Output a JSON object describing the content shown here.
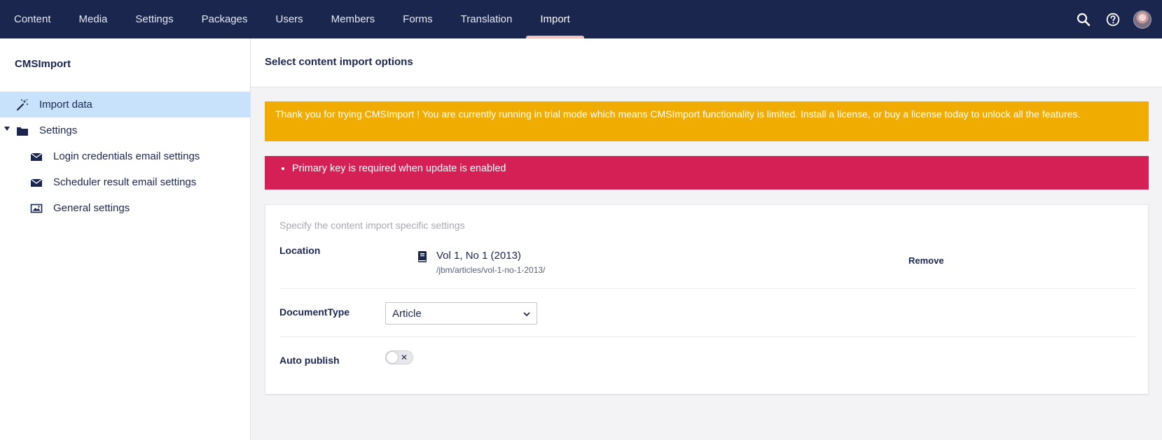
{
  "topnav": {
    "items": [
      {
        "label": "Content"
      },
      {
        "label": "Media"
      },
      {
        "label": "Settings"
      },
      {
        "label": "Packages"
      },
      {
        "label": "Users"
      },
      {
        "label": "Members"
      },
      {
        "label": "Forms"
      },
      {
        "label": "Translation"
      },
      {
        "label": "Import",
        "active": true
      }
    ],
    "tools": {
      "search_icon": "search-icon",
      "help_icon": "help-icon",
      "avatar": "user-avatar"
    }
  },
  "sidebar": {
    "title": "CMSImport",
    "items": [
      {
        "label": "Import data",
        "icon": "wand-icon",
        "selected": true
      },
      {
        "label": "Settings",
        "icon": "folder-icon",
        "expanded": true
      },
      {
        "label": "Login credentials email settings",
        "icon": "envelope-icon"
      },
      {
        "label": "Scheduler result email settings",
        "icon": "envelope-icon"
      },
      {
        "label": "General settings",
        "icon": "picture-icon"
      }
    ]
  },
  "main": {
    "title": "Select content import options",
    "warning": "Thank you for trying CMSImport ! You are currently running in trial mode which means CMSImport functionality is limited. Install a license, or buy a license today to unlock all the features.",
    "errors": [
      "Primary key is required when update is enabled"
    ],
    "panel": {
      "description": "Specify the content import specific settings",
      "location": {
        "label": "Location",
        "name": "Vol 1, No 1 (2013)",
        "path": "/jbm/articles/vol-1-no-1-2013/",
        "remove_label": "Remove",
        "icon": "book-icon"
      },
      "document_type": {
        "label": "DocumentType",
        "selected": "Article"
      },
      "auto_publish": {
        "label": "Auto publish",
        "checked": false
      }
    }
  },
  "colors": {
    "nav_bg": "#1b264f",
    "warning": "#f0ac00",
    "error": "#d42054",
    "selected_row": "#c9e2fb"
  }
}
